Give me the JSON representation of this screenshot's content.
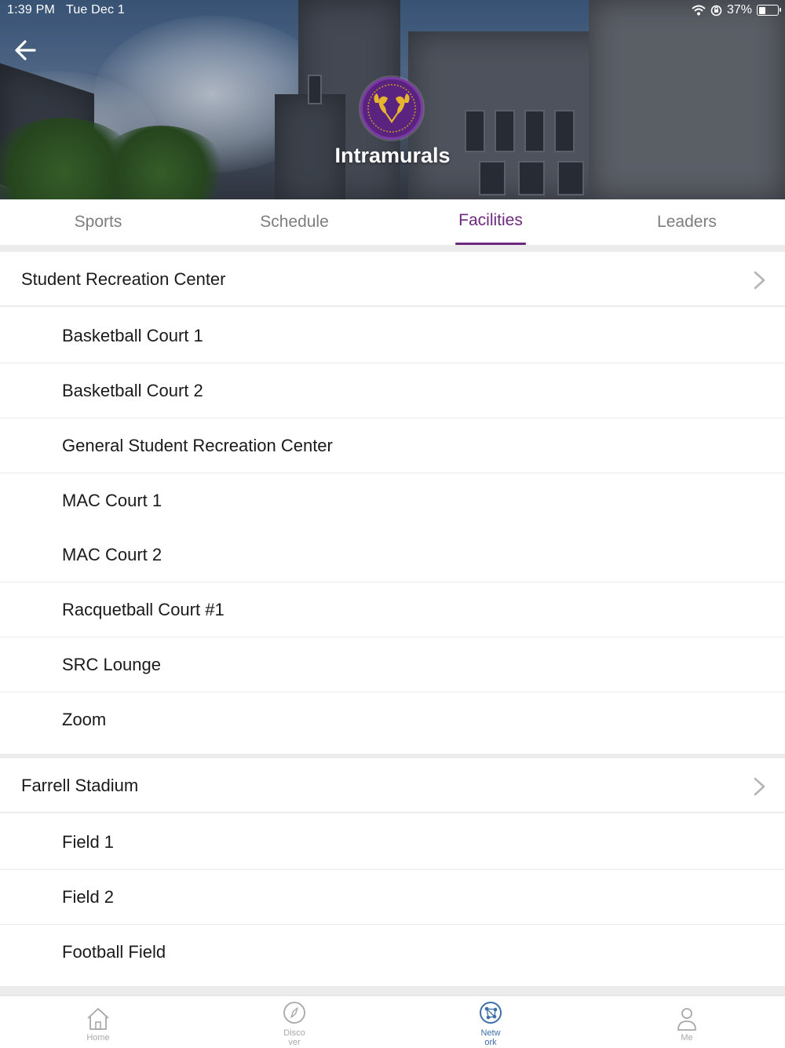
{
  "status_bar": {
    "time": "1:39 PM",
    "date": "Tue Dec 1",
    "battery": "37%",
    "battery_level": 0.37
  },
  "header": {
    "title": "Intramurals",
    "back_icon": "arrow-left-icon",
    "logo": "ram-crest-logo"
  },
  "tabs": [
    {
      "label": "Sports",
      "active": false
    },
    {
      "label": "Schedule",
      "active": false
    },
    {
      "label": "Facilities",
      "active": true
    },
    {
      "label": "Leaders",
      "active": false
    }
  ],
  "facilities": [
    {
      "name": "Student Recreation Center",
      "items": [
        "Basketball Court 1",
        "Basketball Court 2",
        "General Student Recreation Center",
        "MAC Court 1",
        "MAC Court 2",
        "Racquetball Court #1",
        "SRC Lounge",
        "Zoom"
      ]
    },
    {
      "name": "Farrell Stadium",
      "items": [
        "Field 1",
        "Field 2",
        "Football Field"
      ]
    }
  ],
  "bottom_nav": [
    {
      "label": "Home",
      "icon": "home-icon",
      "active": false
    },
    {
      "label": "Disco ver",
      "icon": "compass-icon",
      "active": false
    },
    {
      "label": "Netw ork",
      "icon": "network-icon",
      "active": true
    },
    {
      "label": "Me",
      "icon": "person-icon",
      "active": false
    }
  ],
  "colors": {
    "accent": "#6b2a7d",
    "nav_active": "#3f6fa8",
    "text": "#1a1a1a",
    "muted": "#7d7d7d"
  }
}
